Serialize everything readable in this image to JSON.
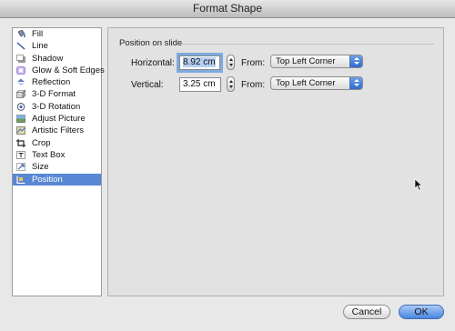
{
  "window": {
    "title": "Format Shape"
  },
  "sidebar": {
    "items": [
      {
        "label": "Fill",
        "icon": "fill-bucket-icon"
      },
      {
        "label": "Line",
        "icon": "line-icon"
      },
      {
        "label": "Shadow",
        "icon": "shadow-icon"
      },
      {
        "label": "Glow & Soft Edges",
        "icon": "glow-icon"
      },
      {
        "label": "Reflection",
        "icon": "reflection-icon"
      },
      {
        "label": "3-D Format",
        "icon": "3d-format-icon"
      },
      {
        "label": "3-D Rotation",
        "icon": "3d-rotation-icon"
      },
      {
        "label": "Adjust Picture",
        "icon": "adjust-picture-icon"
      },
      {
        "label": "Artistic Filters",
        "icon": "artistic-filters-icon"
      },
      {
        "label": "Crop",
        "icon": "crop-icon"
      },
      {
        "label": "Text Box",
        "icon": "text-box-icon"
      },
      {
        "label": "Size",
        "icon": "size-icon"
      },
      {
        "label": "Position",
        "icon": "position-icon"
      }
    ],
    "selected": "Position"
  },
  "position": {
    "group_label": "Position on slide",
    "horizontal": {
      "label": "Horizontal:",
      "value": "8.92 cm",
      "from_label": "From:",
      "from_value": "Top Left Corner"
    },
    "vertical": {
      "label": "Vertical:",
      "value": "3.25 cm",
      "from_label": "From:",
      "from_value": "Top Left Corner"
    }
  },
  "buttons": {
    "cancel": "Cancel",
    "ok": "OK"
  },
  "colors": {
    "selection": "#5887d4",
    "accent": "#4a86e0"
  }
}
